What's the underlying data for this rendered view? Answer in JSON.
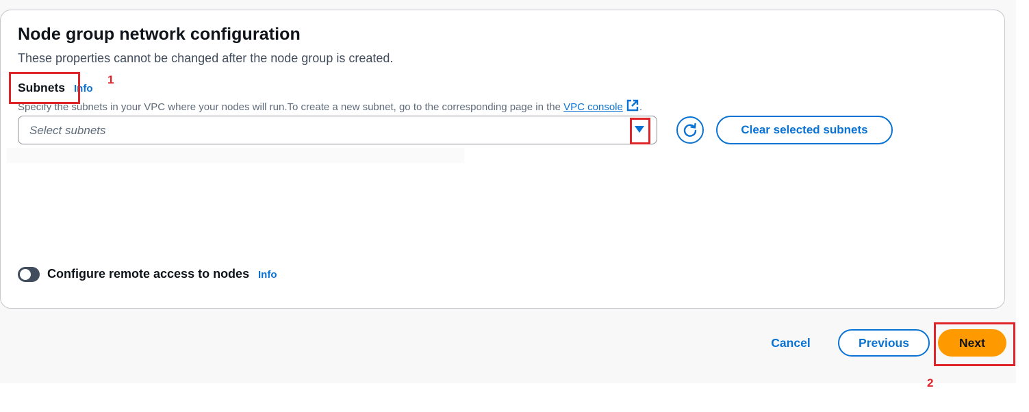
{
  "section": {
    "title": "Node group network configuration",
    "subtitle": "These properties cannot be changed after the node group is created."
  },
  "subnets": {
    "label": "Subnets",
    "info": "Info",
    "description_prefix": "Specify the subnets in your VPC where your nodes will run.To create a new subnet, go to the corresponding page in the ",
    "description_link": "VPC console",
    "description_suffix": ".",
    "select_placeholder": "Select subnets",
    "clear_button": "Clear selected subnets"
  },
  "remote_access": {
    "label": "Configure remote access to nodes",
    "info": "Info",
    "enabled": false
  },
  "footer": {
    "cancel": "Cancel",
    "previous": "Previous",
    "next": "Next"
  },
  "annotations": {
    "marker_1": "1",
    "marker_2": "2",
    "color": "#e0252a"
  },
  "colors": {
    "link": "#0972d3",
    "primary_button": "#ff9900",
    "toggle_off": "#414d5c"
  },
  "icons": {
    "external_link": "external-link-icon",
    "refresh": "refresh-icon",
    "caret": "caret-down-icon"
  }
}
